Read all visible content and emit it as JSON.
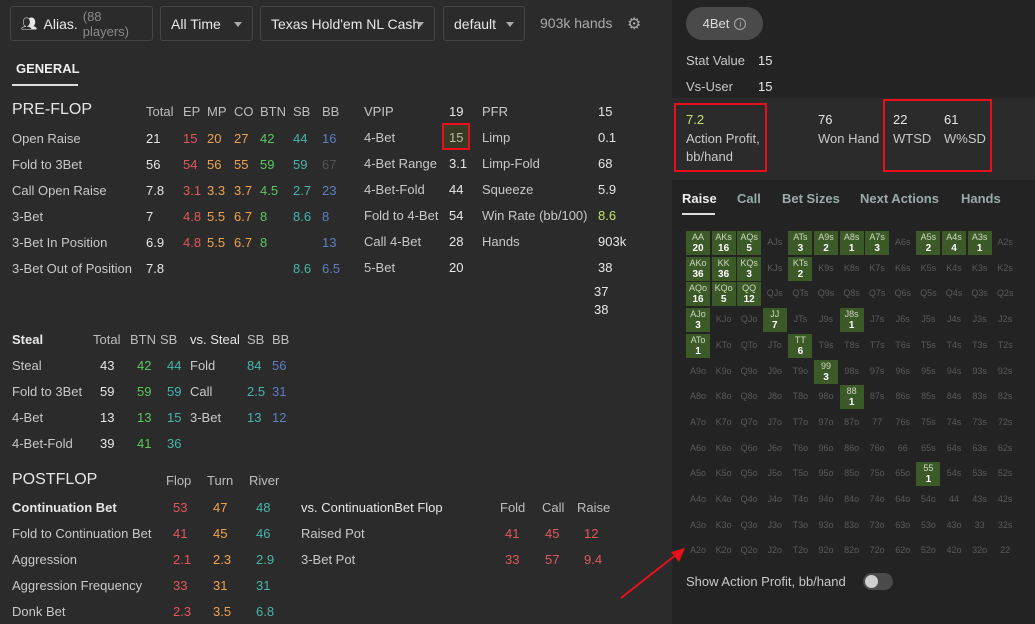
{
  "toolbar": {
    "alias_label": "Alias.",
    "players": "(88 players)",
    "time_range": "All Time",
    "game_type": "Texas Hold'em NL Cash",
    "preset": "default",
    "hands": "903k hands"
  },
  "tab_general": "GENERAL",
  "preflop": {
    "title": "PRE-FLOP",
    "headers": [
      "Total",
      "EP",
      "MP",
      "CO",
      "BTN",
      "SB",
      "BB"
    ],
    "rows": [
      {
        "label": "Open Raise",
        "vals": [
          "21",
          "15",
          "20",
          "27",
          "42",
          "44",
          "16"
        ]
      },
      {
        "label": "Fold to 3Bet",
        "vals": [
          "56",
          "54",
          "56",
          "55",
          "59",
          "59",
          "67"
        ]
      },
      {
        "label": "Call Open Raise",
        "vals": [
          "7.8",
          "3.1",
          "3.3",
          "3.7",
          "4.5",
          "2.7",
          "23"
        ]
      },
      {
        "label": "3-Bet",
        "vals": [
          "7",
          "4.8",
          "5.5",
          "6.7",
          "8",
          "8.6",
          "8"
        ]
      },
      {
        "label": "3-Bet In Position",
        "vals": [
          "6.9",
          "4.8",
          "5.5",
          "6.7",
          "8",
          "",
          "13"
        ]
      },
      {
        "label": "3-Bet Out of Position",
        "vals": [
          "7.8",
          "",
          "",
          "",
          "",
          "8.6",
          "6.5"
        ]
      }
    ],
    "mid": [
      {
        "label": "VPIP",
        "val": "19"
      },
      {
        "label": "4-Bet",
        "val": "15"
      },
      {
        "label": "4-Bet Range",
        "val": "3.1"
      },
      {
        "label": "4-Bet-Fold",
        "val": "44"
      },
      {
        "label": "Fold to 4-Bet",
        "val": "54"
      },
      {
        "label": "Call 4-Bet",
        "val": "28"
      },
      {
        "label": "5-Bet",
        "val": "20"
      }
    ],
    "right": [
      {
        "label": "PFR",
        "val": "15"
      },
      {
        "label": "Limp",
        "val": "0.1"
      },
      {
        "label": "Limp-Fold",
        "val": "68"
      },
      {
        "label": "Squeeze",
        "val": "5.9"
      },
      {
        "label": "Win Rate (bb/100)",
        "val": "8.6"
      },
      {
        "label": "Hands",
        "val": "903k"
      },
      {
        "label": "",
        "val": "38"
      }
    ],
    "extra": [
      "37",
      "38"
    ]
  },
  "steal": {
    "title": "Steal",
    "headers": [
      "Total",
      "BTN",
      "SB"
    ],
    "rows": [
      {
        "label": "Steal",
        "vals": [
          "43",
          "42",
          "44"
        ]
      },
      {
        "label": "Fold to 3Bet",
        "vals": [
          "59",
          "59",
          "59"
        ]
      },
      {
        "label": "4-Bet",
        "vals": [
          "13",
          "13",
          "15"
        ]
      },
      {
        "label": "4-Bet-Fold",
        "vals": [
          "39",
          "41",
          "36"
        ]
      }
    ],
    "vs_title": "vs. Steal",
    "vs_headers": [
      "SB",
      "BB"
    ],
    "vs_rows": [
      {
        "label": "Fold",
        "vals": [
          "84",
          "56"
        ]
      },
      {
        "label": "Call",
        "vals": [
          "2.5",
          "31"
        ]
      },
      {
        "label": "3-Bet",
        "vals": [
          "13",
          "12"
        ]
      }
    ]
  },
  "postflop": {
    "title": "POSTFLOP",
    "headers": [
      "Flop",
      "Turn",
      "River"
    ],
    "rows": [
      {
        "label": "Continuation Bet",
        "vals": [
          "53",
          "47",
          "48"
        ]
      },
      {
        "label": "Fold to Continuation Bet",
        "vals": [
          "41",
          "45",
          "46"
        ]
      },
      {
        "label": "Aggression",
        "vals": [
          "2.1",
          "2.3",
          "2.9"
        ]
      },
      {
        "label": "Aggression Frequency",
        "vals": [
          "33",
          "31",
          "31"
        ]
      },
      {
        "label": "Donk Bet",
        "vals": [
          "2.3",
          "3.5",
          "6.8"
        ]
      }
    ],
    "vs_title": "vs. ContinuationBet Flop",
    "vs_headers": [
      "Fold",
      "Call",
      "Raise"
    ],
    "vs_rows": [
      {
        "label": "Raised Pot",
        "vals": [
          "41",
          "45",
          "12"
        ]
      },
      {
        "label": "3-Bet Pot",
        "vals": [
          "33",
          "57",
          "9.4"
        ]
      }
    ]
  },
  "panel": {
    "stat_chip": "4Bet",
    "stat_value_label": "Stat Value",
    "stat_value": "15",
    "vs_user_label": "Vs-User",
    "vs_user": "15",
    "action_profit": "7.2",
    "action_profit_label": "Action Profit, bb/hand",
    "won_hand": "76",
    "won_hand_label": "Won Hand",
    "wtsd": "22",
    "wtsd_label": "WTSD",
    "wsd": "61",
    "wsd_label": "W%SD",
    "tabs": [
      "Raise",
      "Call",
      "Bet Sizes",
      "Next Actions",
      "Hands"
    ],
    "toggle_label": "Show Action Profit, bb/hand",
    "toggle_on": false
  },
  "matrix_values": {
    "AA": "20",
    "AKs": "16",
    "AQs": "5",
    "ATs": "3",
    "A9s": "2",
    "A8s": "1",
    "A7s": "3",
    "A5s": "2",
    "A4s": "4",
    "A3s": "1",
    "AKo": "36",
    "KK": "36",
    "KQs": "3",
    "KTs": "2",
    "AQo": "16",
    "KQo": "5",
    "QQ": "12",
    "AJo": "3",
    "JJ": "7",
    "J8s": "1",
    "ATo": "1",
    "TT": "6",
    "99": "3",
    "88": "1",
    "55": "1"
  },
  "colors": {
    "accent_red": "#e8111b",
    "green_cell": "#3b5a27"
  }
}
